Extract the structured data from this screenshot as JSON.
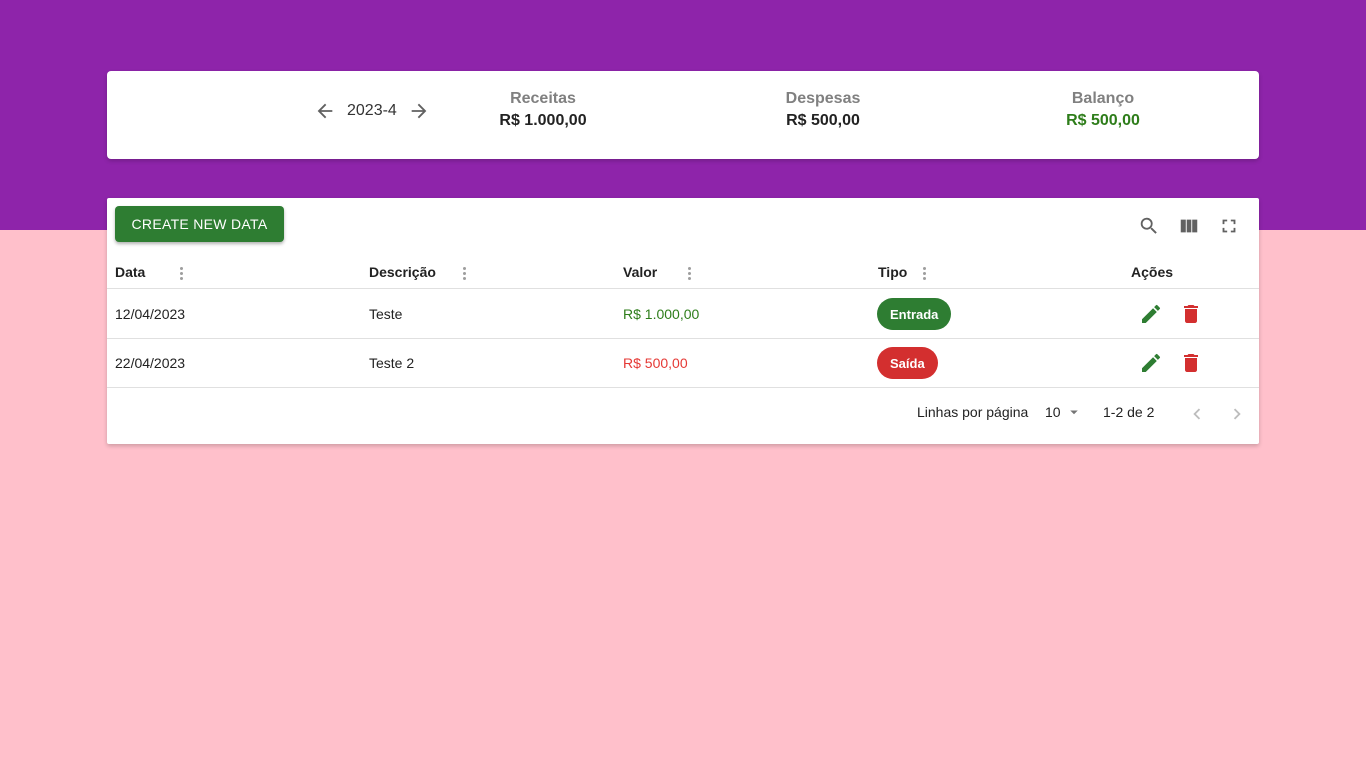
{
  "summary": {
    "month": "2023-4",
    "receitas": {
      "title": "Receitas",
      "value": "R$ 1.000,00"
    },
    "despesas": {
      "title": "Despesas",
      "value": "R$ 500,00"
    },
    "balanco": {
      "title": "Balanço",
      "value": "R$ 500,00",
      "color": "#2e7d1a"
    }
  },
  "toolbar": {
    "create_label": "CREATE NEW DATA",
    "icons": [
      "search-icon",
      "view-column-icon",
      "fullscreen-icon"
    ]
  },
  "table": {
    "columns": [
      {
        "label": "Data"
      },
      {
        "label": "Descrição"
      },
      {
        "label": "Valor"
      },
      {
        "label": "Tipo"
      },
      {
        "label": "Ações"
      }
    ],
    "rows": [
      {
        "data": "12/04/2023",
        "descricao": "Teste",
        "valor": "R$ 1.000,00",
        "tipo": "Entrada"
      },
      {
        "data": "22/04/2023",
        "descricao": "Teste 2",
        "valor": "R$ 500,00",
        "tipo": "Saída"
      }
    ]
  },
  "pagination": {
    "rows_per_page_label": "Linhas por página",
    "rows_per_page_value": "10",
    "range": "1-2 de 2"
  },
  "colors": {
    "header_band": "#8e24aa",
    "background": "#ffc0cb",
    "primary_green": "#2e7d32",
    "danger_red": "#d32f2f"
  }
}
